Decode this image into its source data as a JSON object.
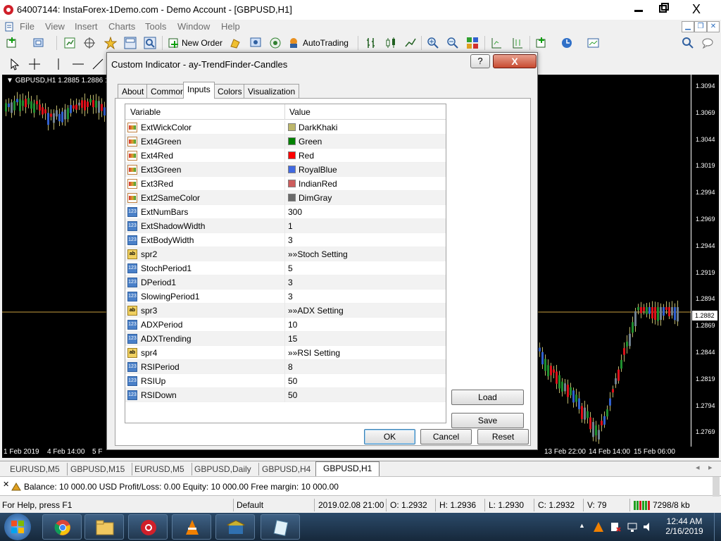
{
  "window": {
    "title": "64007144: InstaForex-1Demo.com - Demo Account - [GBPUSD,H1]",
    "minimize_icon": "minimize-icon",
    "close_glyph": "X"
  },
  "menu": [
    "File",
    "View",
    "Insert",
    "Charts",
    "Tools",
    "Window",
    "Help"
  ],
  "toolbar": {
    "new_order_label": "New Order",
    "autotrading_label": "AutoTrading"
  },
  "chart": {
    "symbol_label": "GBPUSD,H1  1.2885 1.2886 1.",
    "prices": [
      "1.3094",
      "1.3069",
      "1.3044",
      "1.3019",
      "1.2994",
      "1.2969",
      "1.2944",
      "1.2919",
      "1.2894",
      "1.2869",
      "1.2844",
      "1.2819",
      "1.2794",
      "1.2769"
    ],
    "current_price": "1.2882",
    "times_left": [
      "1 Feb 2019",
      "4 Feb 14:00",
      "5 F"
    ],
    "times_right": [
      "13 Feb 22:00",
      "14 Feb 14:00",
      "15 Feb 06:00"
    ],
    "colors": {
      "bull": "#1f8f2f",
      "bear": "#e0101a",
      "neutral": "#708090",
      "blue": "#3060d0",
      "price_line": "#c8a040"
    }
  },
  "chart_tabs": [
    {
      "label": "EURUSD,M5",
      "active": false
    },
    {
      "label": "GBPUSD,M15",
      "active": false
    },
    {
      "label": "EURUSD,M5",
      "active": false
    },
    {
      "label": "GBPUSD,Daily",
      "active": false
    },
    {
      "label": "GBPUSD,H4",
      "active": false
    },
    {
      "label": "GBPUSD,H1",
      "active": true
    }
  ],
  "terminal": {
    "text": "Balance: 10 000.00 USD  Profit/Loss: 0.00  Equity: 10 000.00  Free margin: 10 000.00"
  },
  "statusbar": {
    "help": "For Help, press F1",
    "profile": "Default",
    "datetime": "2019.02.08 21:00",
    "open": "O: 1.2932",
    "high": "H: 1.2936",
    "low": "L: 1.2930",
    "close": "C: 1.2932",
    "volume": "V: 79",
    "traffic": "7298/8 kb"
  },
  "taskbar": {
    "time": "12:44 AM",
    "date": "2/16/2019"
  },
  "dialog": {
    "title": "Custom Indicator - ay-TrendFinder-Candles",
    "help_glyph": "?",
    "close_glyph": "X",
    "tabs": [
      "About",
      "Common",
      "Inputs",
      "Colors",
      "Visualization"
    ],
    "active_tab": "Inputs",
    "columns": {
      "variable": "Variable",
      "value": "Value"
    },
    "rows": [
      {
        "type": "color",
        "name": "ExtWickColor",
        "value": "DarkKhaki",
        "swatch": "#bdb76b"
      },
      {
        "type": "color",
        "name": "Ext4Green",
        "value": "Green",
        "swatch": "#008000"
      },
      {
        "type": "color",
        "name": "Ext4Red",
        "value": "Red",
        "swatch": "#ff0000"
      },
      {
        "type": "color",
        "name": "Ext3Green",
        "value": "RoyalBlue",
        "swatch": "#4169e1"
      },
      {
        "type": "color",
        "name": "Ext3Red",
        "value": "IndianRed",
        "swatch": "#cd5c5c"
      },
      {
        "type": "color",
        "name": "Ext2SameColor",
        "value": "DimGray",
        "swatch": "#696969"
      },
      {
        "type": "int",
        "name": "ExtNumBars",
        "value": "300"
      },
      {
        "type": "int",
        "name": "ExtShadowWidth",
        "value": "1"
      },
      {
        "type": "int",
        "name": "ExtBodyWidth",
        "value": "3"
      },
      {
        "type": "str",
        "name": "spr2",
        "value": "»»Stoch Setting"
      },
      {
        "type": "int",
        "name": "StochPeriod1",
        "value": "5"
      },
      {
        "type": "int",
        "name": "DPeriod1",
        "value": "3"
      },
      {
        "type": "int",
        "name": "SlowingPeriod1",
        "value": "3"
      },
      {
        "type": "str",
        "name": "spr3",
        "value": "»»ADX Setting"
      },
      {
        "type": "int",
        "name": "ADXPeriod",
        "value": "10"
      },
      {
        "type": "int",
        "name": "ADXTrending",
        "value": "15"
      },
      {
        "type": "str",
        "name": "spr4",
        "value": "»»RSI Setting"
      },
      {
        "type": "int",
        "name": "RSIPeriod",
        "value": "8"
      },
      {
        "type": "int",
        "name": "RSIUp",
        "value": "50"
      },
      {
        "type": "int",
        "name": "RSIDown",
        "value": "50"
      }
    ],
    "icon_labels": {
      "int": "123",
      "str": "ab"
    },
    "buttons": {
      "load": "Load",
      "save": "Save",
      "ok": "OK",
      "cancel": "Cancel",
      "reset": "Reset"
    }
  }
}
